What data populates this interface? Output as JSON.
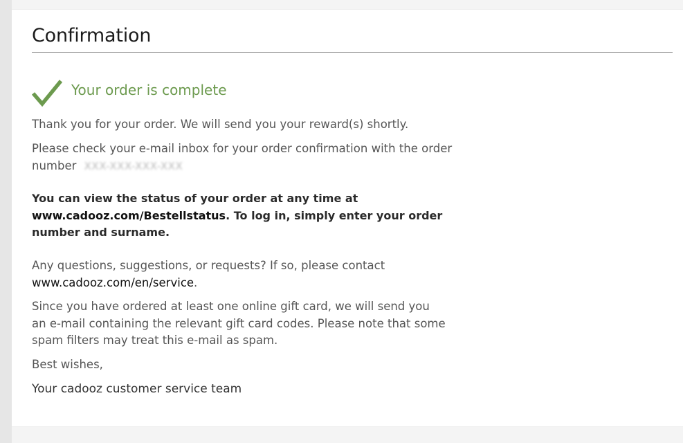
{
  "page": {
    "title": "Confirmation",
    "status_heading": "Your order is complete",
    "check_icon": "checkmark-icon"
  },
  "content": {
    "thanks": "Thank you for your order. We will send you your reward(s) shortly.",
    "inbox_prefix": "Please check your e-mail inbox for your order confirmation with the order number",
    "order_number_masked": "XXX-XXX-XXX-XXX",
    "status_prefix": "You can view the status of your order at any time at ",
    "status_link": "www.cadooz.com/Bestellstatus",
    "status_suffix": ". To log in, simply enter your order number and surname.",
    "questions_prefix": "Any questions, suggestions, or requests? If so, please contact ",
    "service_link": "www.cadooz.com/en/service",
    "questions_suffix": ".",
    "giftcard_note": "Since you have ordered at least one online gift card, we will send you an e-mail containing the relevant gift card codes. Please note that some spam filters may treat this e-mail as spam.",
    "greeting": "Best wishes,",
    "signature": "Your cadooz customer service team"
  },
  "colors": {
    "success_green": "#6c9a4e",
    "text_gray": "#555555",
    "rule_gray": "#8a8a8a"
  }
}
